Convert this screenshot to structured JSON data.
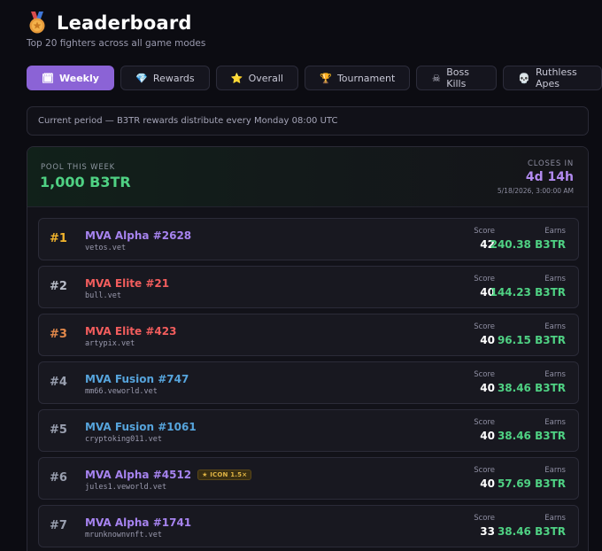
{
  "header": {
    "title": "Leaderboard",
    "subtitle": "Top 20 fighters across all game modes"
  },
  "tabs": [
    {
      "icon": "🗓",
      "label": "Weekly",
      "active": true
    },
    {
      "icon": "💎",
      "label": "Rewards"
    },
    {
      "icon": "⭐",
      "label": "Overall"
    },
    {
      "icon": "🏆",
      "label": "Tournament"
    },
    {
      "icon": "☠",
      "label": "Boss Kills"
    },
    {
      "icon": "💀",
      "label": "Ruthless Apes"
    }
  ],
  "period": {
    "text": "Current period — B3TR rewards distribute every Monday 08:00 UTC"
  },
  "pool": {
    "label": "POOL THIS WEEK",
    "value": "1,000 B3TR",
    "closes_label": "CLOSES IN",
    "closes_value": "4d 14h",
    "closes_date": "5/18/2026, 3:00:00 AM"
  },
  "labels": {
    "score": "Score",
    "earns": "Earns"
  },
  "rows": [
    {
      "rank": "#1",
      "name": "MVA Alpha #2628",
      "owner": "vetos.vet",
      "score": "42",
      "earns": "240.38 B3TR"
    },
    {
      "rank": "#2",
      "name": "MVA Elite #21",
      "owner": "bull.vet",
      "score": "40",
      "earns": "144.23 B3TR"
    },
    {
      "rank": "#3",
      "name": "MVA Elite #423",
      "owner": "artypix.vet",
      "score": "40",
      "earns": "96.15 B3TR"
    },
    {
      "rank": "#4",
      "name": "MVA Fusion #747",
      "owner": "mm66.veworld.vet",
      "score": "40",
      "earns": "38.46 B3TR"
    },
    {
      "rank": "#5",
      "name": "MVA Fusion #1061",
      "owner": "cryptoking011.vet",
      "score": "40",
      "earns": "38.46 B3TR"
    },
    {
      "rank": "#6",
      "name": "MVA Alpha #4512",
      "owner": "jules1.veworld.vet",
      "score": "40",
      "earns": "57.69 B3TR",
      "badge": "★ ICON 1.5×"
    },
    {
      "rank": "#7",
      "name": "MVA Alpha #1741",
      "owner": "mrunknownvnft.vet",
      "score": "33",
      "earns": "38.46 B3TR"
    }
  ],
  "colors": {
    "accent": "#8b63d6",
    "earn_green": "#4fd183",
    "gold": "#f2b42c",
    "bronze": "#e2884a",
    "alpha": "#a683ef",
    "elite": "#f25d5d",
    "fusion": "#56a4dc"
  }
}
